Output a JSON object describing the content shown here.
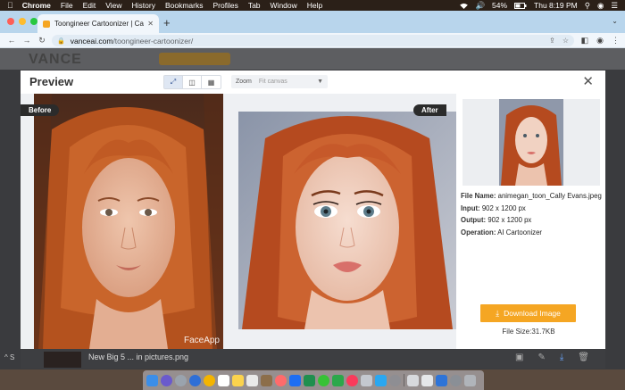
{
  "menubar": {
    "app": "Chrome",
    "items": [
      "File",
      "Edit",
      "View",
      "History",
      "Bookmarks",
      "Profiles",
      "Tab",
      "Window",
      "Help"
    ],
    "battery": "54%",
    "clock": "Thu 8:19 PM"
  },
  "browser": {
    "tab_title": "Toongineer Cartoonizer | Carto",
    "url_host": "vanceai.com",
    "url_path": "/toongineer-cartoonizer/"
  },
  "page": {
    "logo_text": "VANCE"
  },
  "modal": {
    "title": "Preview",
    "zoom_label": "Zoom",
    "zoom_placeholder": "Fit canvas",
    "before_label": "Before",
    "after_label": "After",
    "watermark": "FaceApp",
    "info": {
      "file_name_label": "File Name:",
      "file_name": "animegan_toon_Cally Evans.jpeg",
      "input_label": "Input:",
      "input_value": "902 x 1200 px",
      "output_label": "Output:",
      "output_value": "902 x 1200 px",
      "operation_label": "Operation:",
      "operation_value": "AI Cartoonizer"
    },
    "download_label": "Download Image",
    "file_size": "File Size:31.7KB"
  },
  "downloads": {
    "item_name": "New Big 5 ... in pictures.png",
    "left_text": "S"
  },
  "colors": {
    "accent": "#f5a623",
    "tabbar": "#b8d5ec",
    "badge": "#2b2b2b"
  }
}
